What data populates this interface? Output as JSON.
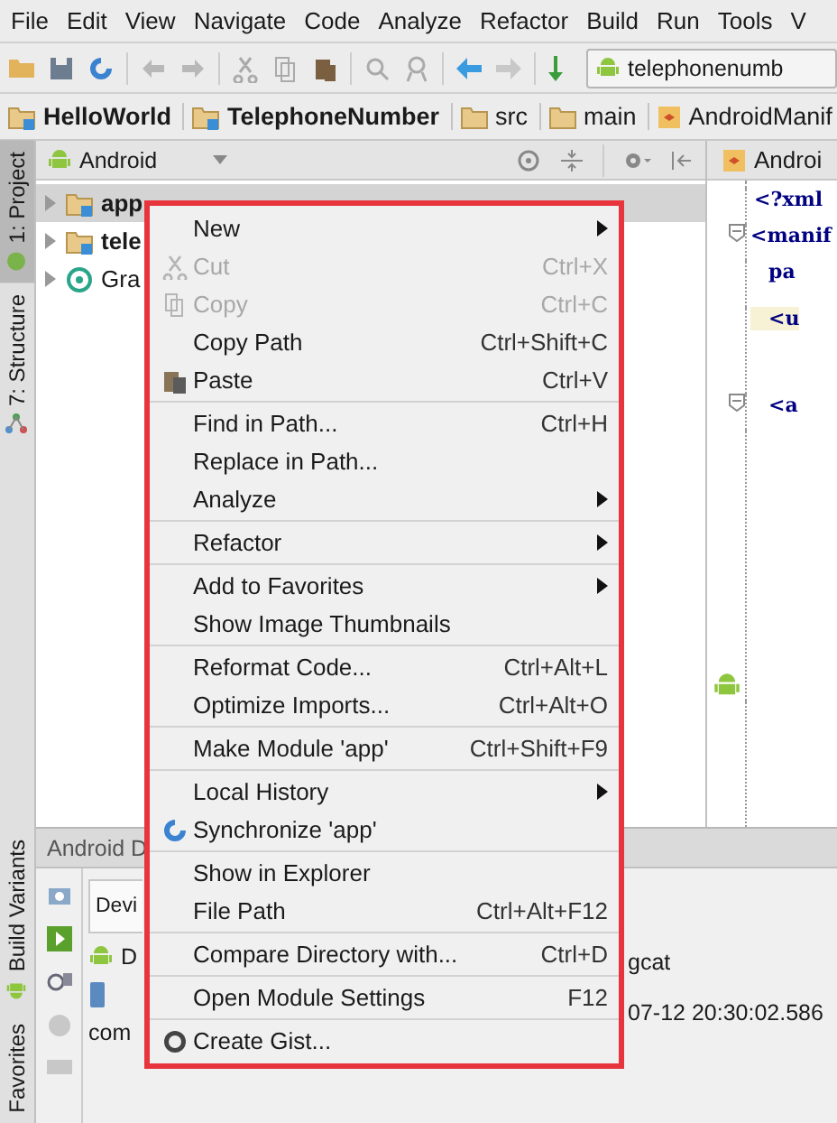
{
  "menubar": [
    "File",
    "Edit",
    "View",
    "Navigate",
    "Code",
    "Analyze",
    "Refactor",
    "Build",
    "Run",
    "Tools",
    "V"
  ],
  "toolbar": {
    "run_config": "telephonenumb"
  },
  "breadcrumbs": [
    {
      "label": "HelloWorld",
      "bold": true,
      "kind": "module"
    },
    {
      "label": "TelephoneNumber",
      "bold": true,
      "kind": "module"
    },
    {
      "label": "src",
      "bold": false,
      "kind": "folder"
    },
    {
      "label": "main",
      "bold": false,
      "kind": "folder"
    },
    {
      "label": "AndroidManif",
      "bold": false,
      "kind": "manifest"
    }
  ],
  "side_tabs_top": [
    {
      "label": "1: Project",
      "selected": true,
      "kind": "project"
    },
    {
      "label": "7: Structure",
      "selected": false,
      "kind": "structure"
    }
  ],
  "side_tabs_bottom": [
    {
      "label": "Build Variants",
      "selected": false,
      "kind": "android"
    },
    {
      "label": "Favorites",
      "selected": false,
      "kind": "plain"
    }
  ],
  "project": {
    "view": "Android",
    "tree": [
      {
        "label": "app",
        "bold": true,
        "kind": "module",
        "selected": true
      },
      {
        "label": "tele",
        "bold": true,
        "kind": "module",
        "selected": false
      },
      {
        "label": "Gra",
        "bold": false,
        "kind": "gradle",
        "selected": false
      }
    ]
  },
  "editor": {
    "tab": "Androi",
    "lines": [
      {
        "text": "<?xml",
        "kind": "decl",
        "fold": false,
        "highlight": false
      },
      {
        "text": "<manif",
        "kind": "tag",
        "fold": true,
        "highlight": false
      },
      {
        "text": "pa",
        "kind": "attr",
        "fold": false,
        "highlight": false
      },
      {
        "text": "<u",
        "kind": "tag2",
        "fold": false,
        "highlight": true
      },
      {
        "text": "<a",
        "kind": "tag2",
        "fold": true,
        "highlight": false
      }
    ]
  },
  "bottom_panel": {
    "title": "Android D",
    "device_label": "Devi",
    "device": "D",
    "process": "com",
    "logcat_tab": "gcat",
    "log_time": "07-12 20:30:02.586"
  },
  "context_menu": {
    "groups": [
      [
        {
          "label": "New",
          "submenu": true,
          "disabled": false,
          "kind": "plain"
        },
        {
          "label": "Cut",
          "shortcut": "Ctrl+X",
          "submenu": false,
          "disabled": true,
          "kind": "cut"
        },
        {
          "label": "Copy",
          "shortcut": "Ctrl+C",
          "submenu": false,
          "disabled": true,
          "kind": "copy"
        },
        {
          "label": "Copy Path",
          "shortcut": "Ctrl+Shift+C",
          "submenu": false,
          "disabled": false,
          "kind": "plain"
        },
        {
          "label": "Paste",
          "shortcut": "Ctrl+V",
          "submenu": false,
          "disabled": false,
          "kind": "paste"
        }
      ],
      [
        {
          "label": "Find in Path...",
          "shortcut": "Ctrl+H",
          "submenu": false,
          "disabled": false,
          "kind": "plain"
        },
        {
          "label": "Replace in Path...",
          "submenu": false,
          "disabled": false,
          "kind": "plain"
        },
        {
          "label": "Analyze",
          "submenu": true,
          "disabled": false,
          "kind": "plain"
        }
      ],
      [
        {
          "label": "Refactor",
          "submenu": true,
          "disabled": false,
          "kind": "plain"
        }
      ],
      [
        {
          "label": "Add to Favorites",
          "submenu": true,
          "disabled": false,
          "kind": "plain"
        },
        {
          "label": "Show Image Thumbnails",
          "submenu": false,
          "disabled": false,
          "kind": "plain"
        }
      ],
      [
        {
          "label": "Reformat Code...",
          "shortcut": "Ctrl+Alt+L",
          "submenu": false,
          "disabled": false,
          "kind": "plain"
        },
        {
          "label": "Optimize Imports...",
          "shortcut": "Ctrl+Alt+O",
          "submenu": false,
          "disabled": false,
          "kind": "plain"
        }
      ],
      [
        {
          "label": "Make Module 'app'",
          "shortcut": "Ctrl+Shift+F9",
          "submenu": false,
          "disabled": false,
          "kind": "plain"
        }
      ],
      [
        {
          "label": "Local History",
          "submenu": true,
          "disabled": false,
          "kind": "plain"
        },
        {
          "label": "Synchronize 'app'",
          "submenu": false,
          "disabled": false,
          "kind": "sync"
        }
      ],
      [
        {
          "label": "Show in Explorer",
          "submenu": false,
          "disabled": false,
          "kind": "plain"
        },
        {
          "label": "File Path",
          "shortcut": "Ctrl+Alt+F12",
          "submenu": false,
          "disabled": false,
          "kind": "plain"
        }
      ],
      [
        {
          "label": "Compare Directory with...",
          "shortcut": "Ctrl+D",
          "submenu": false,
          "disabled": false,
          "kind": "plain"
        }
      ],
      [
        {
          "label": "Open Module Settings",
          "shortcut": "F12",
          "submenu": false,
          "disabled": false,
          "kind": "plain"
        }
      ],
      [
        {
          "label": "Create Gist...",
          "submenu": false,
          "disabled": false,
          "kind": "gist"
        }
      ]
    ]
  }
}
